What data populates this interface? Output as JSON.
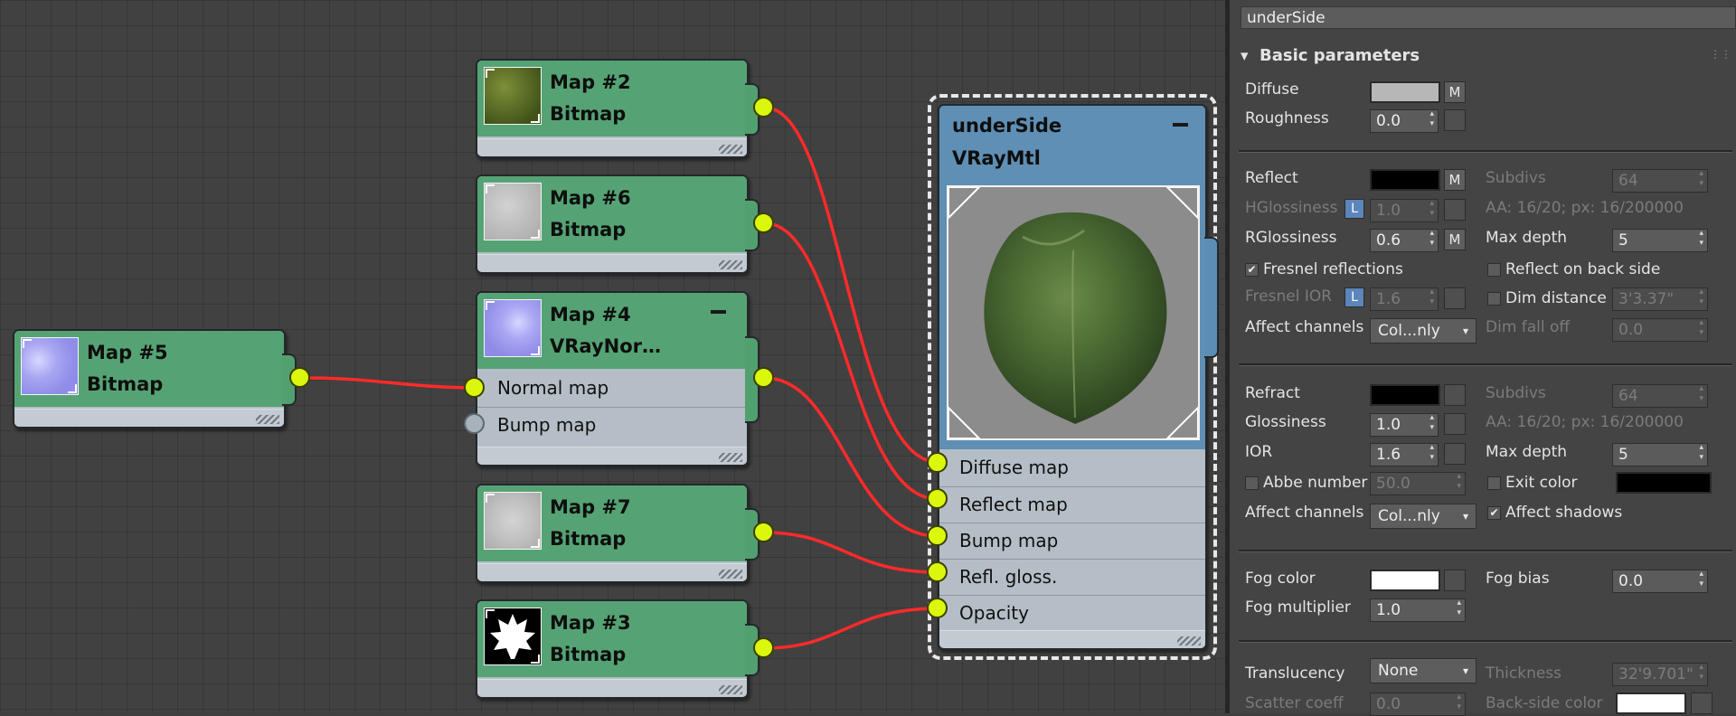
{
  "graph": {
    "nodes": [
      {
        "id": "map5",
        "title": "Map #5",
        "type": "Bitmap",
        "thumb": "normal-texture"
      },
      {
        "id": "map2",
        "title": "Map #2",
        "type": "Bitmap",
        "thumb": "grass-texture"
      },
      {
        "id": "map6",
        "title": "Map #6",
        "type": "Bitmap",
        "thumb": "gray-noise-texture"
      },
      {
        "id": "map4",
        "title": "Map #4",
        "type": "VRayNor…",
        "thumb": "normal-texture",
        "slots": [
          "Normal map",
          "Bump map"
        ]
      },
      {
        "id": "map7",
        "title": "Map #7",
        "type": "Bitmap",
        "thumb": "gray-noise-texture"
      },
      {
        "id": "map3",
        "title": "Map #3",
        "type": "Bitmap",
        "thumb": "leaf-silhouette"
      }
    ],
    "material": {
      "title": "underSide",
      "type": "VRayMtl",
      "slots": [
        "Diffuse map",
        "Reflect map",
        "Bump map",
        "Refl. gloss.",
        "Opacity"
      ]
    },
    "wire_color": "#ff2a2a",
    "socket_color": "#dbf70c",
    "node_color": "#55a374",
    "material_header_color": "#5f8fb4"
  },
  "panel": {
    "material_name": "underSide",
    "rollout_title": "Basic parameters",
    "diffuse": {
      "label": "Diffuse",
      "color": "#b7b7b7",
      "map_btn": "M"
    },
    "roughness": {
      "label": "Roughness",
      "value": "0.0"
    },
    "reflect": {
      "label": "Reflect",
      "color": "#000000",
      "map_btn": "M",
      "subdivs_label": "Subdivs",
      "subdivs": "64",
      "hgloss_label": "HGlossiness",
      "lock_btn": "L",
      "hgloss": "1.0",
      "aa_text": "AA: 16/20; px: 16/200000",
      "rgloss_label": "RGlossiness",
      "rgloss": "0.6",
      "rgloss_map_btn": "M",
      "maxdepth_label": "Max depth",
      "maxdepth": "5",
      "fresnel_label": "Fresnel reflections",
      "fresnel_checked": "✔",
      "backside_label": "Reflect on back side",
      "fresnel_ior_label": "Fresnel IOR",
      "fresnel_ior_lock": "L",
      "fresnel_ior": "1.6",
      "dim_dist_label": "Dim distance",
      "dim_dist": "3'3.37\"",
      "affect_label": "Affect channels",
      "affect_value": "Col...nly",
      "dim_falloff_label": "Dim fall off",
      "dim_falloff": "0.0"
    },
    "refract": {
      "label": "Refract",
      "color": "#000000",
      "subdivs_label": "Subdivs",
      "subdivs": "64",
      "gloss_label": "Glossiness",
      "gloss": "1.0",
      "aa_text": "AA: 16/20; px: 16/200000",
      "ior_label": "IOR",
      "ior": "1.6",
      "maxdepth_label": "Max depth",
      "maxdepth": "5",
      "abbe_label": "Abbe number",
      "abbe": "50.0",
      "exit_label": "Exit color",
      "exit_color": "#000000",
      "affect_label": "Affect channels",
      "affect_value": "Col...nly",
      "affect_shadows_label": "Affect shadows",
      "affect_shadows_checked": "✔"
    },
    "fog": {
      "color_label": "Fog color",
      "color": "#ffffff",
      "bias_label": "Fog bias",
      "bias": "0.0",
      "mult_label": "Fog multiplier",
      "mult": "1.0"
    },
    "translucency": {
      "label": "Translucency",
      "value": "None",
      "thickness_label": "Thickness",
      "thickness": "32'9.701\"",
      "scatter_label": "Scatter coeff",
      "scatter": "0.0",
      "backside_label": "Back-side color",
      "backside_color": "#ffffff"
    }
  }
}
